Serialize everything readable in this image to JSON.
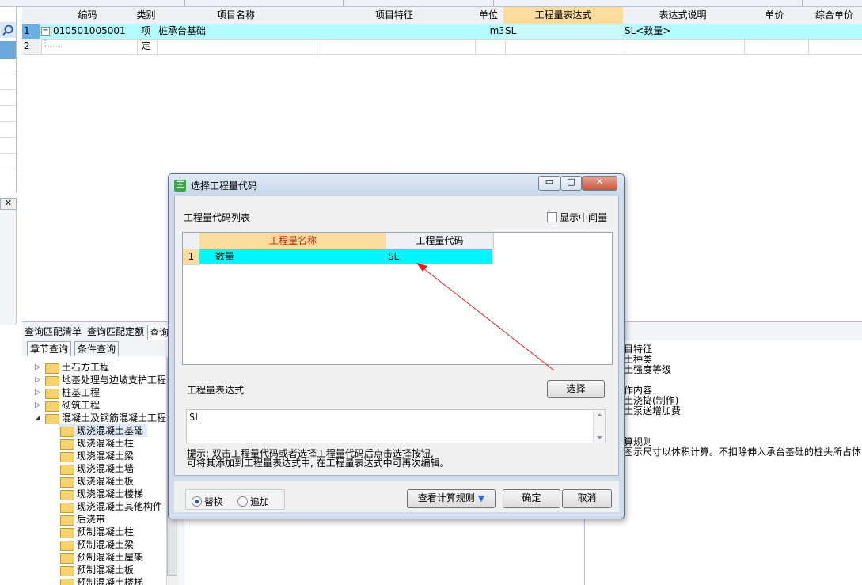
{
  "grid": {
    "headers": [
      "编码",
      "类别",
      "项目名称",
      "项目特征",
      "单位",
      "工程量表达式",
      "表达式说明",
      "单价",
      "综合单价"
    ],
    "rows": [
      {
        "num": "1",
        "code": "010501005001",
        "type": "项",
        "name": "桩承台基础",
        "feature": "",
        "unit": "m3",
        "expr": "SL",
        "expr_desc": "SL<数量>",
        "price": "",
        "total": ""
      },
      {
        "num": "2",
        "code": "",
        "type": "定",
        "name": "",
        "feature": "",
        "unit": "",
        "expr": "",
        "expr_desc": "",
        "price": "",
        "total": ""
      }
    ],
    "left_close": "✕"
  },
  "bottom": {
    "tabs": [
      "查询匹配清单",
      "查询匹配定额",
      "查询"
    ],
    "subtabs": [
      "章节查询",
      "条件查询"
    ],
    "tree": [
      {
        "label": "土石方工程",
        "level": 0,
        "arrow": "▷"
      },
      {
        "label": "地基处理与边坡支护工程",
        "level": 0,
        "arrow": "▷"
      },
      {
        "label": "桩基工程",
        "level": 0,
        "arrow": "▷"
      },
      {
        "label": "砌筑工程",
        "level": 0,
        "arrow": "▷"
      },
      {
        "label": "混凝土及钢筋混凝土工程",
        "level": 0,
        "arrow": "◢"
      },
      {
        "label": "现浇混凝土基础",
        "level": 1,
        "arrow": ""
      },
      {
        "label": "现浇混凝土柱",
        "level": 1,
        "arrow": ""
      },
      {
        "label": "现浇混凝土梁",
        "level": 1,
        "arrow": ""
      },
      {
        "label": "现浇混凝土墙",
        "level": 1,
        "arrow": ""
      },
      {
        "label": "现浇混凝土板",
        "level": 1,
        "arrow": ""
      },
      {
        "label": "现浇混凝土楼梯",
        "level": 1,
        "arrow": ""
      },
      {
        "label": "现浇混凝土其他构件",
        "level": 1,
        "arrow": ""
      },
      {
        "label": "后浇带",
        "level": 1,
        "arrow": ""
      },
      {
        "label": "预制混凝土柱",
        "level": 1,
        "arrow": ""
      },
      {
        "label": "预制混凝土梁",
        "level": 1,
        "arrow": ""
      },
      {
        "label": "预制混凝土屋架",
        "level": 1,
        "arrow": ""
      },
      {
        "label": "预制混凝土板",
        "level": 1,
        "arrow": ""
      },
      {
        "label": "预制混凝土楼梯",
        "level": 1,
        "arrow": ""
      }
    ],
    "right_text": [
      "目特征",
      "土种类",
      "土强度等级",
      "",
      "作内容",
      "土浇捣(制作)",
      "土泵送增加费",
      "",
      "",
      "算规则",
      "图示尺寸以体积计算。不扣除伸入承台基础的桩头所占体"
    ]
  },
  "dialog": {
    "title": "选择工程量代码",
    "icon_glyph": "王",
    "list_title": "工程量代码列表",
    "show_middle": "显示中间量",
    "list_headers": [
      "工程量名称",
      "工程量代码"
    ],
    "list_rows": [
      {
        "num": "1",
        "name": "数量",
        "code": "SL"
      }
    ],
    "expr_label": "工程量表达式",
    "choose_btn": "选择",
    "expr_value": "SL",
    "hint_line1": "提示: 双击工程量代码或者选择工程量代码后点击选择按钮,",
    "hint_line2": "可将其添加到工程量表达式中, 在工程量表达式中可再次编辑。",
    "radio_replace": "替换",
    "radio_append": "追加",
    "view_rules_btn": "查看计算规则",
    "ok_btn": "确定",
    "cancel_btn": "取消",
    "minimize": "▭",
    "maximize": "□",
    "close": "✕"
  },
  "colors": {
    "highlight_header": "#fbdc9c",
    "row_cyan": "#b4fbff",
    "dialog_cyan": "#00f5ff",
    "arrow_red": "#e02020"
  }
}
